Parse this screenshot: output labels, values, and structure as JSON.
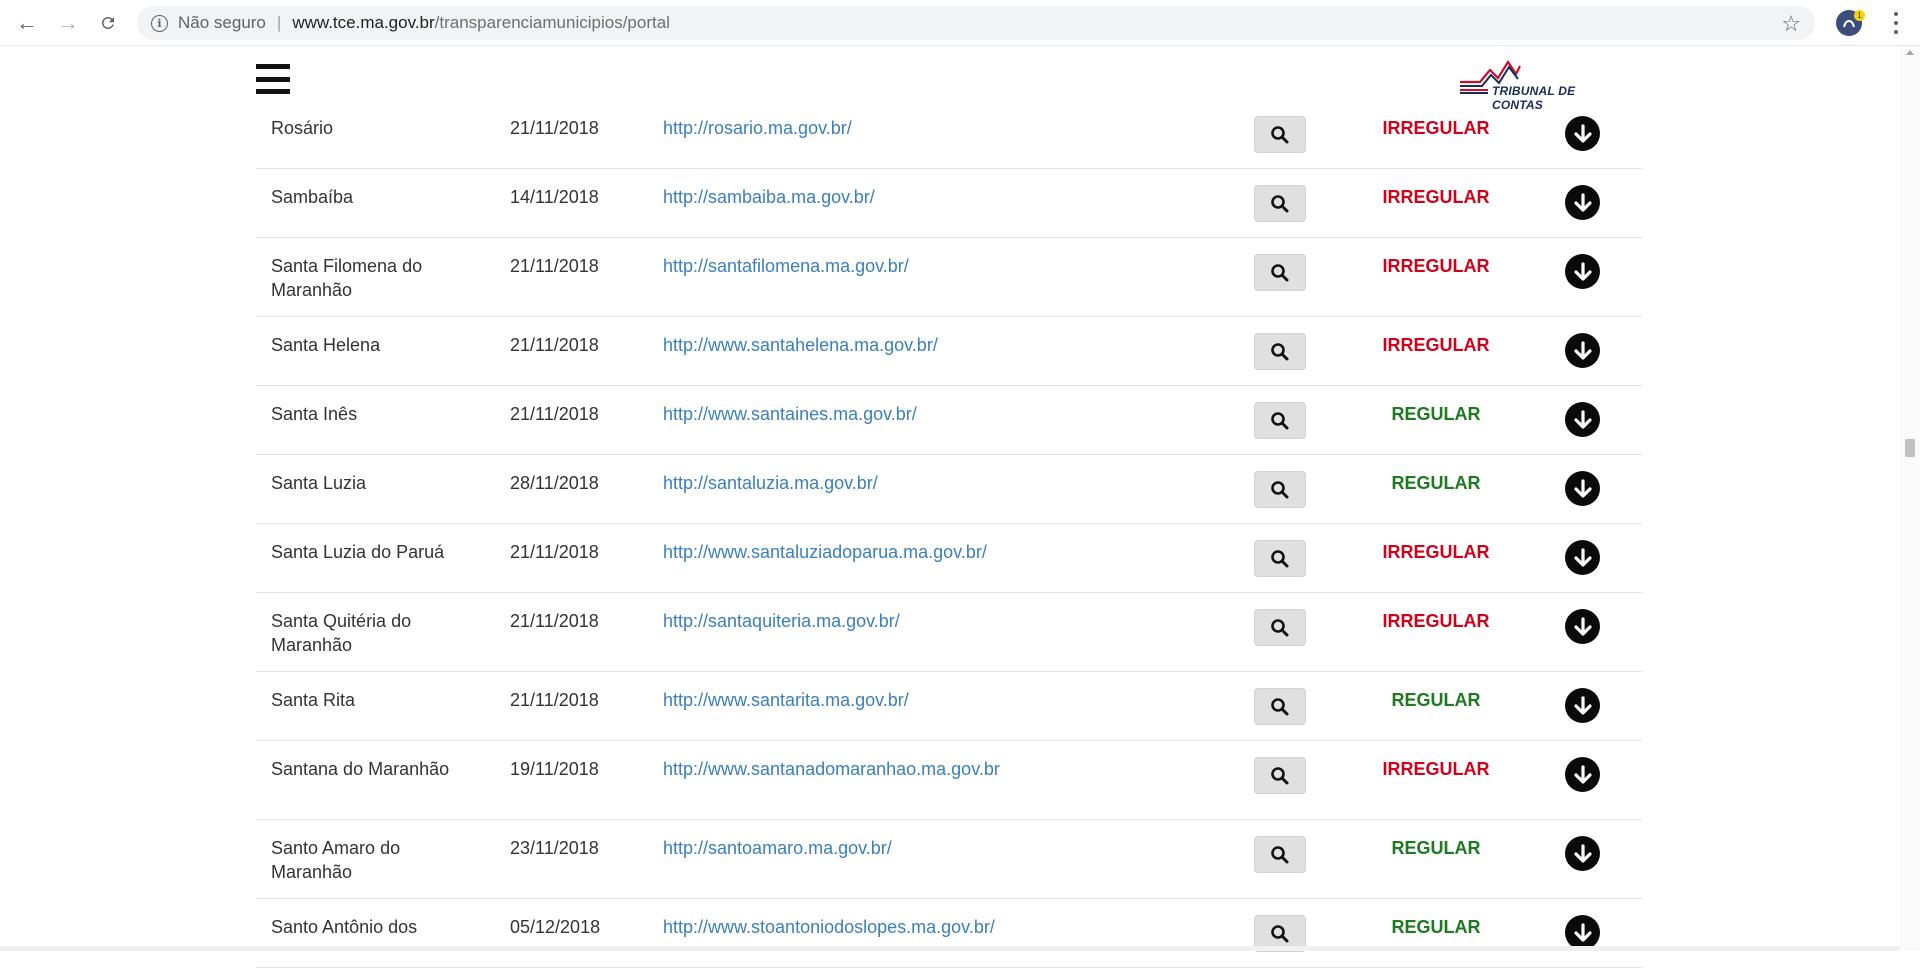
{
  "browser": {
    "security_label": "Não seguro",
    "separator": "|",
    "url_host": "www.tce.ma.gov.br",
    "url_path": "/transparenciamunicipios/portal",
    "ext_badge": "1"
  },
  "header": {
    "logo_text": "TRIBUNAL DE CONTAS"
  },
  "rows": [
    {
      "name": "Rosário",
      "date": "21/11/2018",
      "url": "http://rosario.ma.gov.br/",
      "status": "IRREGULAR"
    },
    {
      "name": "Sambaíba",
      "date": "14/11/2018",
      "url": "http://sambaiba.ma.gov.br/",
      "status": "IRREGULAR"
    },
    {
      "name": "Santa Filomena do Maranhão",
      "date": "21/11/2018",
      "url": "http://santafilomena.ma.gov.br/",
      "status": "IRREGULAR"
    },
    {
      "name": "Santa Helena",
      "date": "21/11/2018",
      "url": "http://www.santahelena.ma.gov.br/",
      "status": "IRREGULAR"
    },
    {
      "name": "Santa Inês",
      "date": "21/11/2018",
      "url": "http://www.santaines.ma.gov.br/",
      "status": "REGULAR"
    },
    {
      "name": "Santa Luzia",
      "date": "28/11/2018",
      "url": "http://santaluzia.ma.gov.br/",
      "status": "REGULAR"
    },
    {
      "name": "Santa Luzia do Paruá",
      "date": "21/11/2018",
      "url": "http://www.santaluziadoparua.ma.gov.br/",
      "status": "IRREGULAR"
    },
    {
      "name": "Santa Quitéria do Maranhão",
      "date": "21/11/2018",
      "url": "http://santaquiteria.ma.gov.br/",
      "status": "IRREGULAR"
    },
    {
      "name": "Santa Rita",
      "date": "21/11/2018",
      "url": "http://www.santarita.ma.gov.br/",
      "status": "REGULAR"
    },
    {
      "name": "Santana do Maranhão",
      "date": "19/11/2018",
      "url": "http://www.santanadomaranhao.ma.gov.br",
      "status": "IRREGULAR"
    },
    {
      "name": "Santo Amaro do Maranhão",
      "date": "23/11/2018",
      "url": "http://santoamaro.ma.gov.br/",
      "status": "REGULAR"
    },
    {
      "name": "Santo Antônio dos",
      "date": "05/12/2018",
      "url": "http://www.stoantoniodoslopes.ma.gov.br/",
      "status": "REGULAR"
    }
  ]
}
